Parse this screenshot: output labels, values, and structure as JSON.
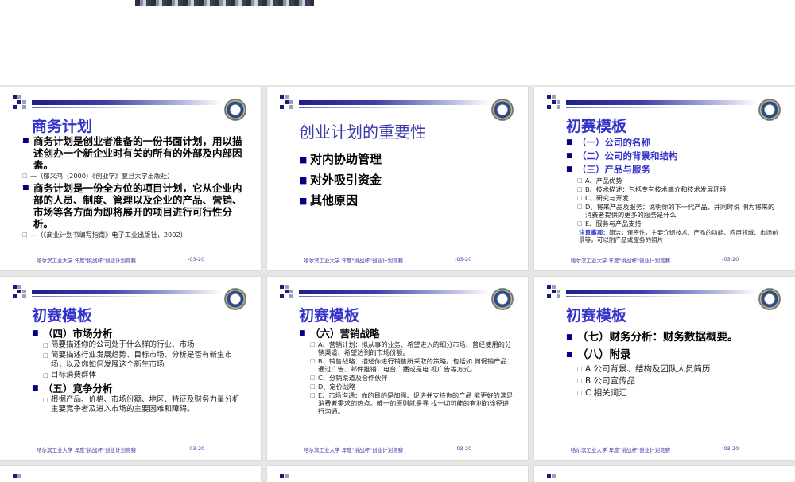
{
  "slides": [
    {
      "title": "商务计划",
      "bullets": [
        {
          "text": "商务计划是创业者准备的一份书面计划，用以描述创办一个新企业时有关的所有的外部及内部因素。",
          "sub": [
            "—（郁义鸿（2000）《创业学》复旦大学出版社）"
          ]
        },
        {
          "text": "商务计划是一份全方位的项目计划，它从企业内部的人员、制度、管理以及企业的产品、营销、市场等各方面为即将展开的项目进行可行性分析。",
          "sub": [
            "—（《商业计划书编写指南》电子工业出版社，2002）"
          ]
        }
      ]
    },
    {
      "title": "创业计划的重要性",
      "bullets": [
        "对内协助管理",
        "对外吸引资金",
        "其他原因"
      ]
    },
    {
      "title": "初赛模板",
      "bullets": [
        "（一）公司的名称",
        "（二）公司的背景和结构",
        "（三）产品与服务"
      ],
      "sub": [
        "A、产品优势",
        "B、技术描述：包括专有技术简介和技术发展环境",
        "C、研究与开发",
        "D、将来产品及服务：说明你的下一代产品，并同时说 明为将来的消费者提供的更多的服务是什么",
        "E、服务与产品支持"
      ],
      "note_label": "注意事项：",
      "note_text": "简洁；保密性，主要介绍技术、产品的功能、应用领域、市场前景等，可以附产品或服务的照片"
    },
    {
      "title": "初赛模板",
      "groups": [
        {
          "head": "（四）市场分析",
          "sub": [
            "简要描述你的公司处于什么样的行业、市场",
            "简要描述行业发展趋势、目标市场、分析是否有新生市场，以及你如何发展这个新生市场",
            "目标消费群体"
          ]
        },
        {
          "head": "（五）竞争分析",
          "sub": [
            "根据产品、价格、市场份额、地区、特征及财务力量分析主要竞争者及进入市场的主要困难和障碍。"
          ]
        }
      ]
    },
    {
      "title": "初赛模板",
      "head": "（六）营销战略",
      "sub": [
        "A、营销计划：拟从事的业务、希望进入的细分市场、曾经使用的分销渠道、希望达到的市场份额。",
        "B、销售战略：描述你进行销售所采取的策略。包括如 何促销产品：通过广告、邮件推销，电台广播或是电 视广告等方式。",
        "C、分销渠道及合作伙伴",
        "D、定价战略",
        "E、市场沟通：你的目的是加强、促进并支持你的产品 能更好的满足消费者需求的热点。唯一的原则就是寻 找一切可能的有利的途径进行沟通。"
      ]
    },
    {
      "title": "初赛模板",
      "bullets": [
        "（七）财务分析：财务数据概要。",
        "（八）附录"
      ],
      "sub": [
        "A 公司背景、结构及团队人员简历",
        "B 公司宣传品",
        "C 相关词汇"
      ]
    }
  ],
  "footer": {
    "label": "哈尔滨工业大学 年度\"挑战杯\"创业计划竞赛",
    "date": "-03-20"
  }
}
